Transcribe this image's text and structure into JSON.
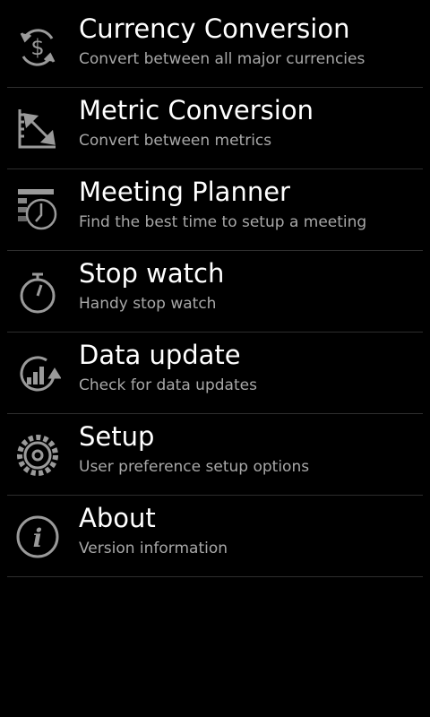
{
  "menu": {
    "items": [
      {
        "title": "Currency Conversion",
        "subtitle": "Convert between all major currencies",
        "icon": "currency-exchange-icon"
      },
      {
        "title": "Metric Conversion",
        "subtitle": "Convert between metrics",
        "icon": "metric-ruler-icon"
      },
      {
        "title": "Meeting Planner",
        "subtitle": "Find the best time to setup a meeting",
        "icon": "calendar-clock-icon"
      },
      {
        "title": "Stop watch",
        "subtitle": "Handy stop watch",
        "icon": "stopwatch-icon"
      },
      {
        "title": "Data update",
        "subtitle": "Check for data updates",
        "icon": "data-update-icon"
      },
      {
        "title": "Setup",
        "subtitle": "User preference setup options",
        "icon": "gear-icon"
      },
      {
        "title": "About",
        "subtitle": "Version information",
        "icon": "info-icon"
      }
    ]
  },
  "colors": {
    "background": "#000000",
    "title": "#ffffff",
    "subtitle": "#a8a8a8",
    "divider": "#2e2e2e",
    "icon": "#9a9a9a"
  }
}
